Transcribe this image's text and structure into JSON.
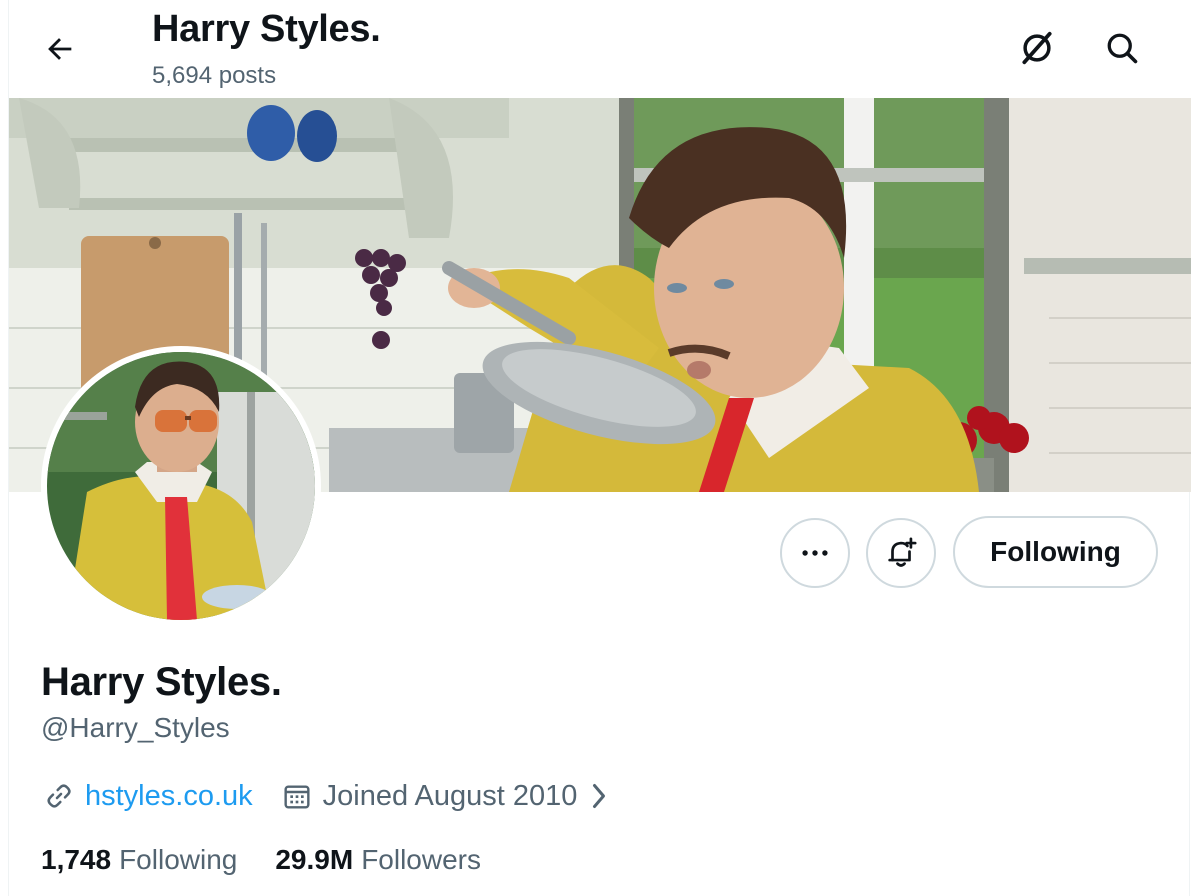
{
  "header": {
    "title": "Harry Styles.",
    "post_count": "5,694 posts",
    "back_icon": "arrow-left-icon",
    "grok_icon": "grok-icon",
    "search_icon": "search-icon"
  },
  "banner": {
    "description_icon": "banner-photo"
  },
  "actions": {
    "more_icon": "more-horizontal-icon",
    "notify_icon": "bell-plus-icon",
    "following_label": "Following"
  },
  "profile": {
    "display_name": "Harry Styles.",
    "handle": "@Harry_Styles",
    "website": "hstyles.co.uk",
    "joined": "Joined August 2010",
    "following_count": "1,748",
    "following_label": "Following",
    "followers_count": "29.9M",
    "followers_label": "Followers"
  },
  "colors": {
    "accent": "#1d9bf0",
    "text": "#0f1419",
    "muted": "#536471",
    "border": "#cfd9de"
  }
}
